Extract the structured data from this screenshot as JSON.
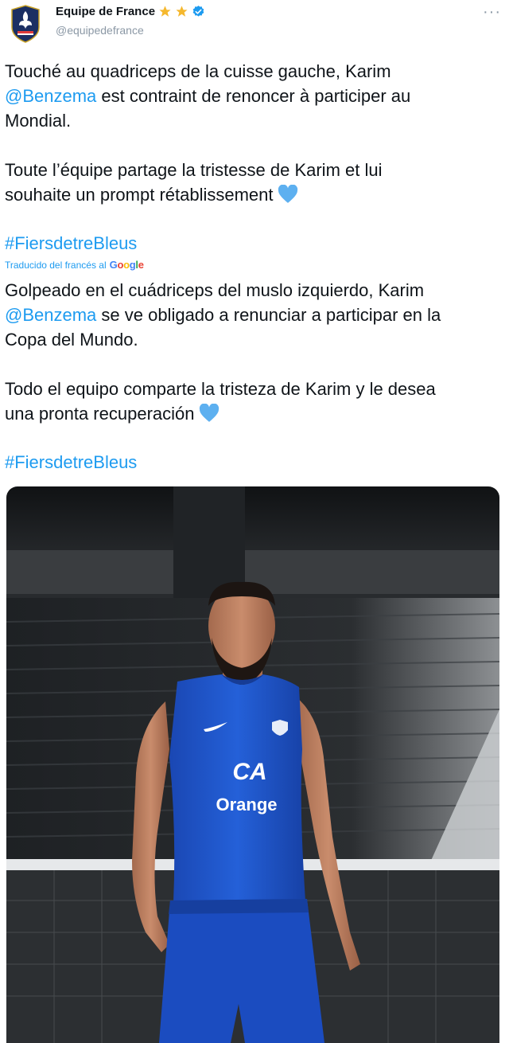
{
  "account": {
    "name": "Equipe de France",
    "handle": "@equipedefrance",
    "verified": true,
    "stars_count": 2,
    "avatar_icon": "fff-crest-logo"
  },
  "tweet": {
    "original": {
      "line1": "Touché au quadriceps de la cuisse gauche, Karim",
      "mention": "@Benzema",
      "line2_rest": " est contraint de renoncer à participer au",
      "line3": "Mondial.",
      "line4": "Toute l’équipe partage la tristesse de Karim et lui",
      "line5": "souhaite un prompt rétablissement",
      "hashtag": "#FiersdetreBleus"
    },
    "translation_label": "Traducido del francés al",
    "translation_brand": "Google",
    "translated": {
      "line1": "Golpeado en el cuádriceps del muslo izquierdo, Karim",
      "mention": "@Benzema",
      "line2_rest": " se ve obligado a renunciar a participar en la",
      "line3": "Copa del Mundo.",
      "line4": "Todo el equipo comparte la tristeza de Karim y le desea",
      "line5": "una pronta recuperación",
      "hashtag": "#FiersdetreBleus"
    }
  },
  "media": {
    "shirt_sponsor_logo": "CA",
    "shirt_sponsor": "Orange"
  },
  "colors": {
    "link": "#1d9bf0",
    "heart": "#5db0f0",
    "star": "#f5b82e",
    "kit_blue": "#1d53c9"
  }
}
